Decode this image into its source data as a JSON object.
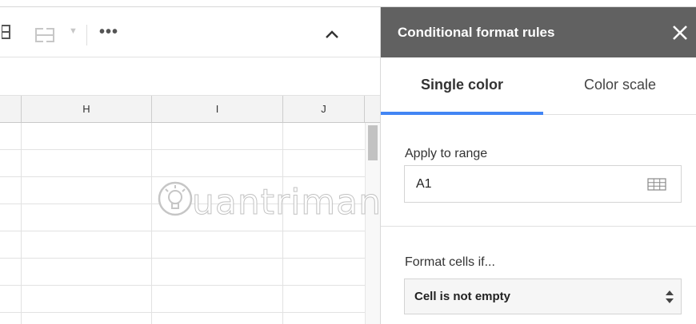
{
  "toolbar": {
    "icons": [
      "borders-icon",
      "merge-cells-icon",
      "chevron-down-icon",
      "more-icon",
      "collapse-icon"
    ],
    "more_label": "•••"
  },
  "sheet": {
    "columns": [
      "H",
      "I",
      "J"
    ],
    "row_count": 7,
    "scrollbar_position": 0.0
  },
  "watermark": {
    "text": "uantrimang"
  },
  "panel": {
    "title": "Conditional format rules",
    "tabs": [
      {
        "label": "Single color",
        "active": true
      },
      {
        "label": "Color scale",
        "active": false
      }
    ],
    "apply_to_range": {
      "label": "Apply to range",
      "value": "A1"
    },
    "format_cells_if": {
      "label": "Format cells if...",
      "selected": "Cell is not empty"
    }
  },
  "colors": {
    "panel_header": "#616161",
    "tab_accent": "#4285f4",
    "header_bg": "#f3f3f3"
  }
}
